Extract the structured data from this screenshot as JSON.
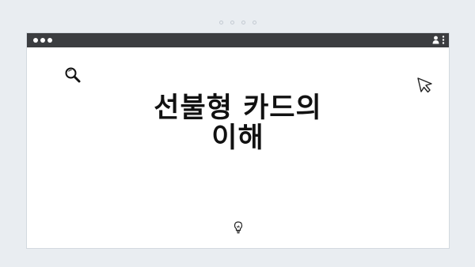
{
  "pager": {
    "count": 4
  },
  "window": {
    "titlebar_color": "#3b3d40",
    "controls": [
      "close-dot",
      "minimize-dot",
      "maximize-dot"
    ],
    "icons": [
      "user-icon",
      "kebab-menu-icon"
    ]
  },
  "content": {
    "headline_line1": "선불형 카드의",
    "headline_line2": "이해",
    "icons": [
      "search-icon",
      "cursor-icon",
      "lightbulb-icon"
    ]
  }
}
